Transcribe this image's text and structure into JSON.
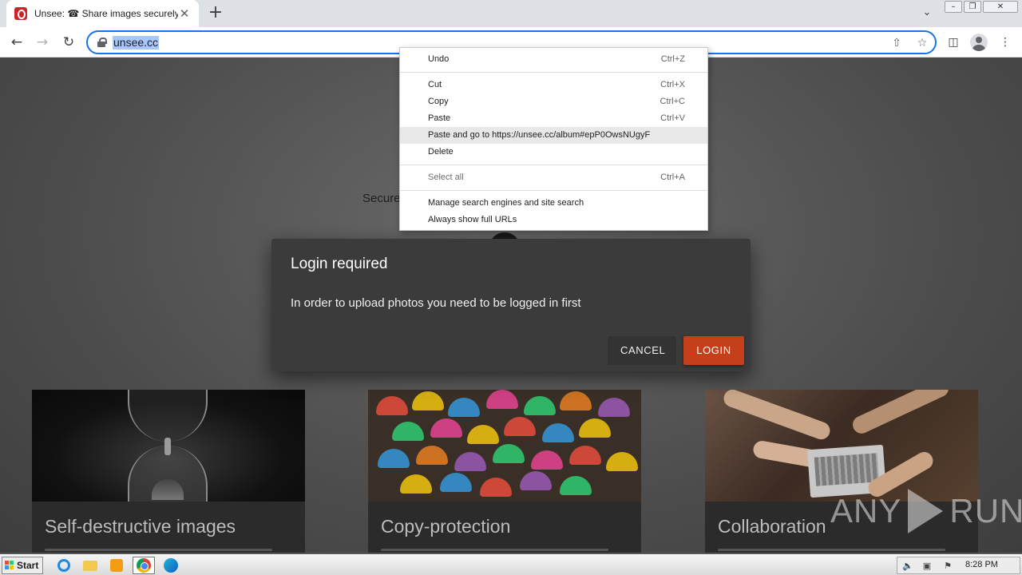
{
  "browser": {
    "tab_title": "Unsee: ☎ Share images securely",
    "tab_close": "✕",
    "new_tab": "+",
    "url": "unsee.cc",
    "window_min": "–",
    "window_max": "❐",
    "window_close": "✕"
  },
  "page": {
    "secure_text": "Secure",
    "cards": [
      {
        "title": "Self-destructive images"
      },
      {
        "title": "Copy-protection"
      },
      {
        "title": "Collaboration"
      }
    ],
    "watermark": {
      "left": "ANY",
      "right": "RUN"
    }
  },
  "dialog": {
    "title": "Login required",
    "message": "In order to upload photos you need to be logged in first",
    "cancel_label": "CANCEL",
    "login_label": "LOGIN",
    "login_color": "#c53f1b"
  },
  "context_menu": {
    "undo": {
      "label": "Undo",
      "shortcut": "Ctrl+Z"
    },
    "cut": {
      "label": "Cut",
      "shortcut": "Ctrl+X"
    },
    "copy": {
      "label": "Copy",
      "shortcut": "Ctrl+C"
    },
    "paste": {
      "label": "Paste",
      "shortcut": "Ctrl+V"
    },
    "paste_go": {
      "label": "Paste and go to https://unsee.cc/album#epP0OwsNUgyF"
    },
    "delete": {
      "label": "Delete"
    },
    "select_all": {
      "label": "Select all",
      "shortcut": "Ctrl+A"
    },
    "manage_search": {
      "label": "Manage search engines and site search"
    },
    "show_full_urls": {
      "label": "Always show full URLs"
    }
  },
  "taskbar": {
    "start_label": "Start",
    "clock": "8:28 PM"
  },
  "colors": {
    "accent": "#1a73e8",
    "url_highlight": "#a8c7fa"
  }
}
